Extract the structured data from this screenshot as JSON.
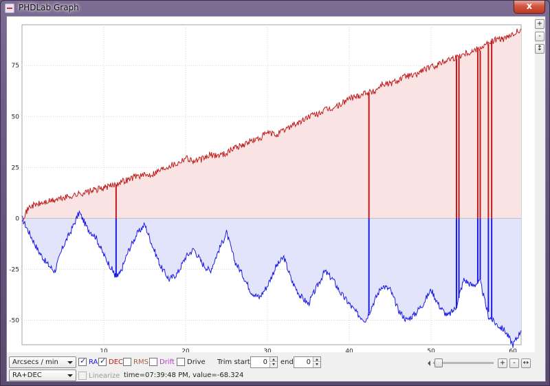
{
  "window": {
    "title": "PHDLab Graph",
    "close_label": "x"
  },
  "zoom": {
    "plus": "+",
    "minus": "-",
    "fit": "↕"
  },
  "colors": {
    "ra": "#1a1ae6",
    "dec": "#c01818",
    "ra_fill": "#e1e4fa",
    "dec_fill": "#f9e3e3",
    "grid": "#d6d6d6",
    "zero": "#bfbfbf"
  },
  "chart_data": {
    "type": "line",
    "xlim": [
      0,
      61
    ],
    "ylim": [
      -62,
      95
    ],
    "x_ticks": [
      10,
      20,
      30,
      40,
      50,
      60
    ],
    "y_ticks": [
      75,
      50,
      25,
      0,
      -25,
      -50
    ],
    "grid": true,
    "series": [
      {
        "name": "RA",
        "x": [
          0,
          1,
          2,
          3,
          4,
          5,
          6,
          7,
          8,
          9,
          10,
          11,
          11.5,
          12,
          13,
          14,
          15,
          16,
          17,
          18,
          19,
          20,
          21,
          22,
          23,
          24,
          25,
          26,
          27,
          28,
          29,
          30,
          31,
          32,
          33,
          34,
          35,
          36,
          37,
          38,
          39,
          40,
          41,
          42,
          43,
          44,
          45,
          46,
          47,
          48,
          49,
          50,
          51,
          52,
          53,
          54,
          55,
          56,
          57,
          58,
          59,
          60,
          61
        ],
        "y": [
          0,
          -8,
          -16,
          -22,
          -26,
          -14,
          -6,
          3,
          -5,
          -9,
          -18,
          -25,
          -29,
          -27,
          -16,
          -8,
          -3,
          -14,
          -24,
          -30,
          -27,
          -19,
          -15,
          -22,
          -26,
          -16,
          -7,
          -21,
          -28,
          -36,
          -39,
          -33,
          -24,
          -19,
          -31,
          -38,
          -42,
          -34,
          -26,
          -30,
          -37,
          -42,
          -47,
          -50,
          -41,
          -33,
          -35,
          -45,
          -50,
          -47,
          -42,
          -35,
          -43,
          -48,
          -44,
          -30,
          -33,
          -31,
          -48,
          -52,
          -55,
          -62,
          -55
        ]
      },
      {
        "name": "DEC",
        "x": [
          0,
          1,
          2,
          3,
          4,
          5,
          6,
          7,
          8,
          9,
          10,
          11,
          12,
          13,
          14,
          15,
          16,
          17,
          18,
          19,
          20,
          21,
          22,
          23,
          24,
          25,
          26,
          27,
          28,
          29,
          30,
          31,
          32,
          33,
          34,
          35,
          36,
          37,
          38,
          39,
          40,
          41,
          42,
          43,
          44,
          45,
          46,
          47,
          48,
          49,
          50,
          51,
          52,
          53,
          54,
          55,
          56,
          57,
          58,
          59,
          60,
          61
        ],
        "y": [
          0,
          6,
          7,
          8,
          9,
          10,
          11,
          12,
          13,
          14,
          15,
          16,
          18,
          19,
          21,
          21,
          22,
          24,
          26,
          27,
          30,
          28,
          29,
          31,
          31,
          32,
          35,
          36,
          38,
          39,
          42,
          41,
          43,
          46,
          47,
          50,
          51,
          53,
          54,
          56,
          59,
          60,
          62,
          62,
          66,
          66,
          68,
          70,
          70,
          73,
          74,
          76,
          78,
          79,
          81,
          82,
          84,
          86,
          88,
          88,
          90,
          93
        ]
      }
    ],
    "spikes": [
      11.5,
      42.4,
      53.1,
      53.4,
      55.7,
      56.0,
      57.0,
      57.4
    ]
  },
  "controls": {
    "units": "Arcsecs / min",
    "mode": "RA+DEC",
    "ra_label": "RA",
    "dec_label": "DEC",
    "rms_label": "RMS",
    "drift_label": "Drift",
    "drive_label": "Drive",
    "linearize_label": "Linearize",
    "trim_start_label": "Trim start:",
    "trim_start_value": "0",
    "trim_end_label": "end:",
    "trim_end_value": "0",
    "status": "time=07:39:48 PM, value=-68.324",
    "scroll_plus": "+",
    "scroll_minus": "-",
    "scroll_fit": "↔"
  }
}
